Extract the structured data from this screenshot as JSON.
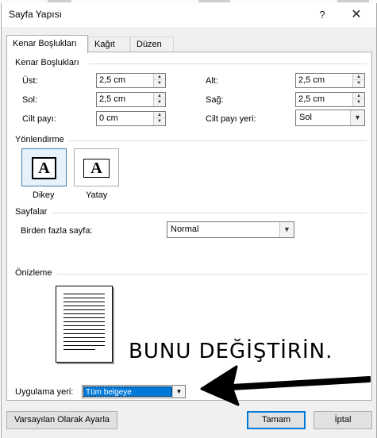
{
  "window": {
    "title": "Sayfa Yapısı",
    "help_glyph": "?",
    "close_glyph": "✕"
  },
  "tabs": [
    {
      "label": "Kenar Boşlukları",
      "active": true
    },
    {
      "label": "Kağıt",
      "active": false
    },
    {
      "label": "Düzen",
      "active": false
    }
  ],
  "margins": {
    "section_title": "Kenar Boşlukları",
    "top_label": "Üst:",
    "top_value": "2,5 cm",
    "bottom_label": "Alt:",
    "bottom_value": "2,5 cm",
    "left_label": "Sol:",
    "left_value": "2,5 cm",
    "right_label": "Sağ:",
    "right_value": "2,5 cm",
    "gutter_label": "Cilt payı:",
    "gutter_value": "0 cm",
    "gutter_pos_label": "Cilt payı yeri:",
    "gutter_pos_value": "Sol"
  },
  "orientation": {
    "section_title": "Yönlendirme",
    "portrait_label": "Dikey",
    "landscape_label": "Yatay",
    "icon_letter": "A",
    "selected": "portrait"
  },
  "pages": {
    "section_title": "Sayfalar",
    "multiple_label": "Birden fazla sayfa:",
    "multiple_value": "Normal"
  },
  "preview": {
    "section_title": "Önizleme",
    "annotation": "BUNU DEĞİŞTİRİN."
  },
  "apply_to": {
    "label": "Uygulama yeri:",
    "value": "Tüm belgeye"
  },
  "buttons": {
    "set_default": "Varsayılan Olarak Ayarla",
    "ok": "Tamam",
    "cancel": "İptal"
  },
  "colors": {
    "accent": "#0078d7",
    "dialog_bg": "#f0f0f0",
    "panel_bg": "#ffffff"
  },
  "icons": [
    "question-mark-icon",
    "close-icon",
    "spin-up-icon",
    "spin-down-icon",
    "chevron-down-icon",
    "page-portrait-icon",
    "page-landscape-icon",
    "arrow-left-icon"
  ]
}
